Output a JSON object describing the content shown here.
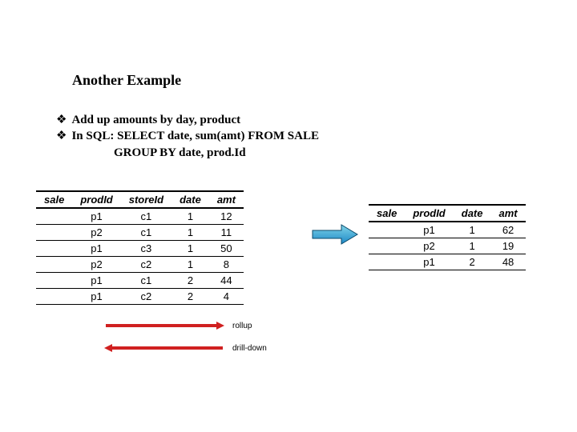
{
  "title": "Another Example",
  "bullets": {
    "b1": "Add up amounts by day, product",
    "b2": "In SQL:  SELECT date, sum(amt) FROM SALE",
    "b2_sub": "GROUP BY date, prod.Id"
  },
  "left_table": {
    "headers": {
      "c0": "sale",
      "c1": "prodId",
      "c2": "storeId",
      "c3": "date",
      "c4": "amt"
    },
    "rows": [
      {
        "c0": "",
        "c1": "p1",
        "c2": "c1",
        "c3": "1",
        "c4": "12"
      },
      {
        "c0": "",
        "c1": "p2",
        "c2": "c1",
        "c3": "1",
        "c4": "11"
      },
      {
        "c0": "",
        "c1": "p1",
        "c2": "c3",
        "c3": "1",
        "c4": "50"
      },
      {
        "c0": "",
        "c1": "p2",
        "c2": "c2",
        "c3": "1",
        "c4": "8"
      },
      {
        "c0": "",
        "c1": "p1",
        "c2": "c1",
        "c3": "2",
        "c4": "44"
      },
      {
        "c0": "",
        "c1": "p1",
        "c2": "c2",
        "c3": "2",
        "c4": "4"
      }
    ]
  },
  "right_table": {
    "headers": {
      "c0": "sale",
      "c1": "prodId",
      "c2": "date",
      "c3": "amt"
    },
    "rows": [
      {
        "c0": "",
        "c1": "p1",
        "c2": "1",
        "c3": "62"
      },
      {
        "c0": "",
        "c1": "p2",
        "c2": "1",
        "c3": "19"
      },
      {
        "c0": "",
        "c1": "p1",
        "c2": "2",
        "c3": "48"
      }
    ]
  },
  "ops": {
    "rollup": "rollup",
    "drilldown": "drill-down"
  },
  "chart_data": {
    "type": "table",
    "title": "Another Example",
    "description": "SQL GROUP BY aggregation (rollup) from detailed SALE table to summary by date and prodId; reverse operation is drill-down.",
    "source_table": {
      "columns": [
        "sale",
        "prodId",
        "storeId",
        "date",
        "amt"
      ],
      "rows": [
        [
          "",
          "p1",
          "c1",
          1,
          12
        ],
        [
          "",
          "p2",
          "c1",
          1,
          11
        ],
        [
          "",
          "p1",
          "c3",
          1,
          50
        ],
        [
          "",
          "p2",
          "c2",
          1,
          8
        ],
        [
          "",
          "p1",
          "c1",
          2,
          44
        ],
        [
          "",
          "p1",
          "c2",
          2,
          4
        ]
      ]
    },
    "result_table": {
      "columns": [
        "sale",
        "prodId",
        "date",
        "amt"
      ],
      "rows": [
        [
          "",
          "p1",
          1,
          62
        ],
        [
          "",
          "p2",
          1,
          19
        ],
        [
          "",
          "p1",
          2,
          48
        ]
      ]
    },
    "sql": "SELECT date, sum(amt) FROM SALE GROUP BY date, prod.Id",
    "operations": {
      "forward": "rollup",
      "reverse": "drill-down"
    }
  }
}
